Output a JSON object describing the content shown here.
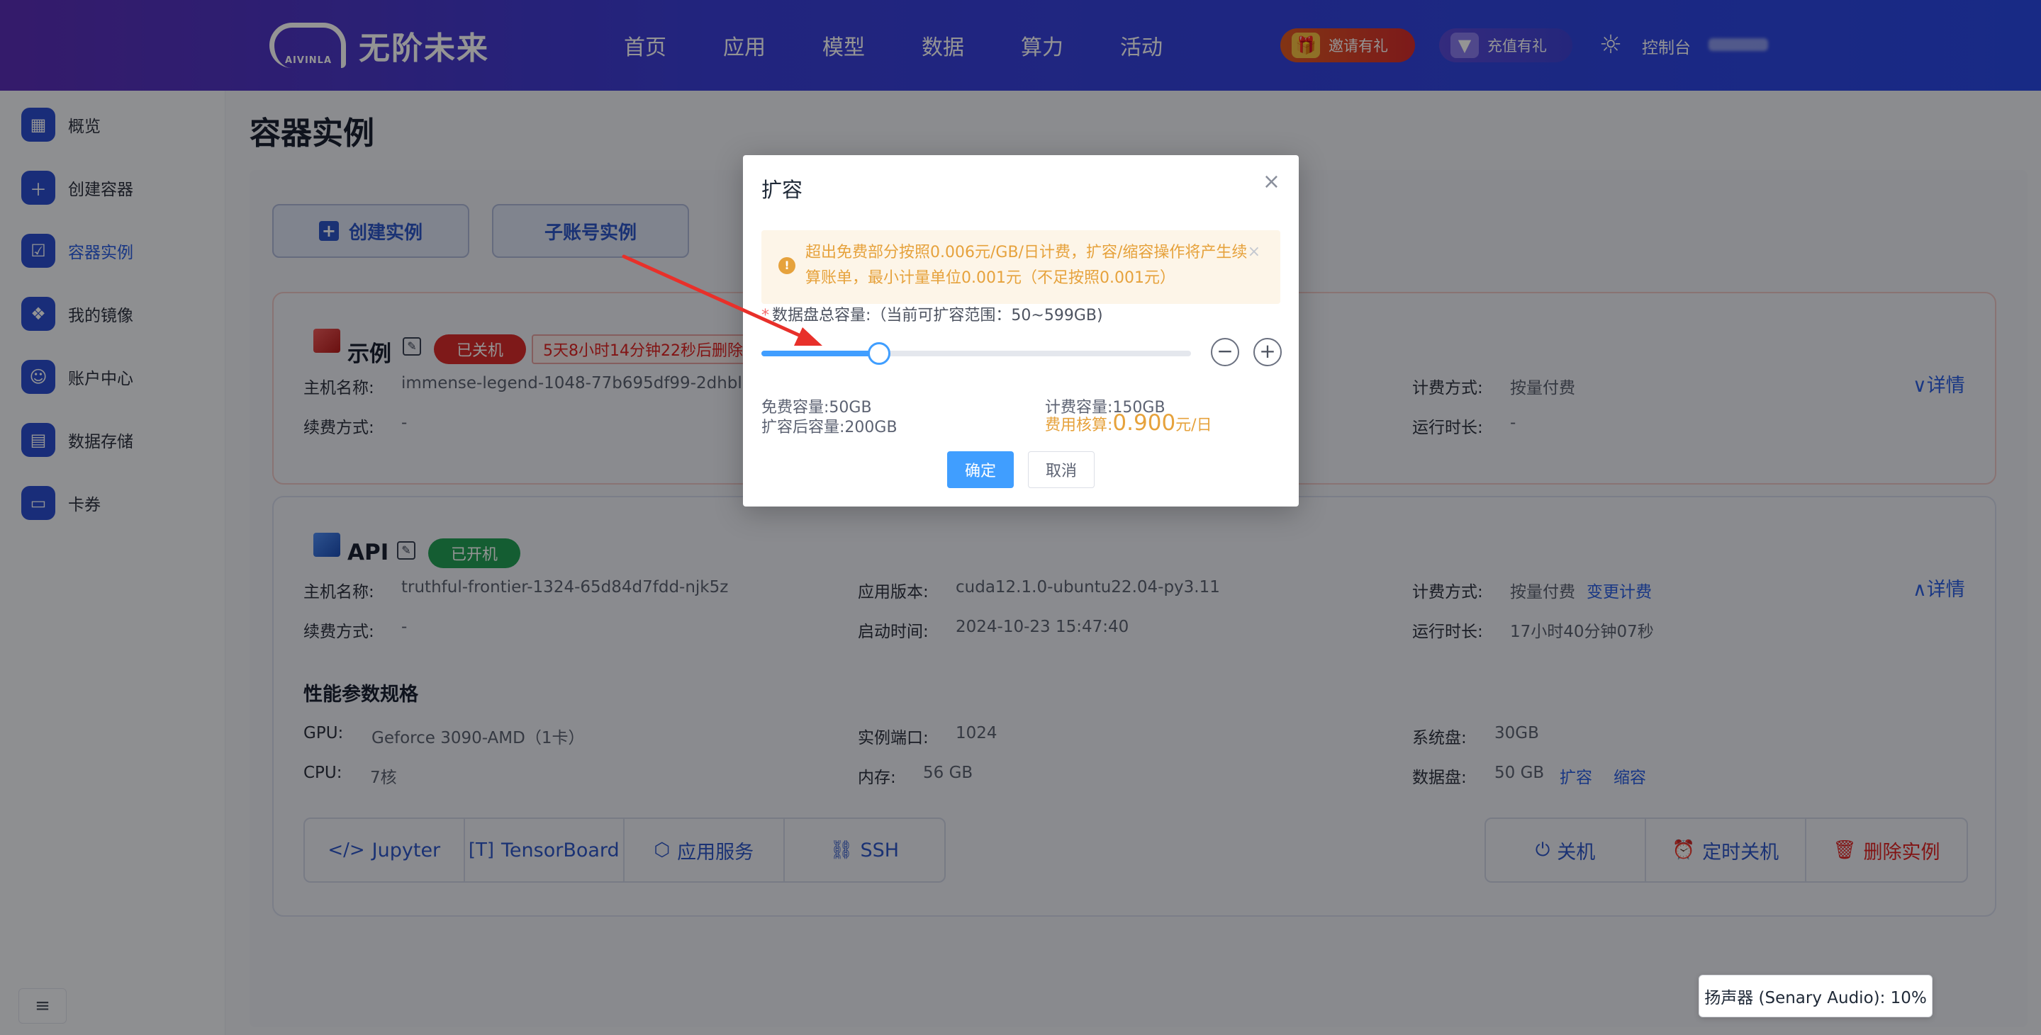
{
  "header": {
    "logo_text": "无阶未来",
    "logo_sub": "AIVINLA",
    "nav": [
      "首页",
      "应用",
      "模型",
      "数据",
      "算力",
      "活动"
    ],
    "invite_label": "邀请有礼",
    "recharge_label": "充值有礼",
    "console_label": "控制台"
  },
  "sidebar": {
    "items": [
      {
        "label": "概览",
        "icon": "grid-icon"
      },
      {
        "label": "创建容器",
        "icon": "plus-icon"
      },
      {
        "label": "容器实例",
        "icon": "checklist-icon",
        "active": true
      },
      {
        "label": "我的镜像",
        "icon": "layers-icon"
      },
      {
        "label": "账户中心",
        "icon": "user-icon"
      },
      {
        "label": "数据存储",
        "icon": "database-icon"
      },
      {
        "label": "卡券",
        "icon": "ticket-icon"
      }
    ],
    "collapse_glyph": "≡"
  },
  "page": {
    "title": "容器实例",
    "create_btn": "创建实例",
    "sub_btn": "子账号实例"
  },
  "card1": {
    "name": "示例",
    "status": "已关机",
    "countdown": "5天8小时14分钟22秒后删除",
    "host_label": "主机名称:",
    "host": "immense-legend-1048-77b695df99-2dhbl",
    "renew_label": "续费方式:",
    "renew": "-",
    "billing_label": "计费方式:",
    "billing": "按量付费",
    "runtime_label": "运行时长:",
    "runtime": "-",
    "detail": "详情"
  },
  "card2": {
    "name": "API",
    "status": "已开机",
    "host_label": "主机名称:",
    "host": "truthful-frontier-1324-65d84d7fdd-njk5z",
    "renew_label": "续费方式:",
    "renew": "-",
    "app_ver_label": "应用版本:",
    "app_ver": "cuda12.1.0-ubuntu22.04-py3.11",
    "start_label": "启动时间:",
    "start": "2024-10-23 15:47:40",
    "billing_label": "计费方式:",
    "billing": "按量付费",
    "change_billing": "变更计费",
    "runtime_label": "运行时长:",
    "runtime": "17小时40分钟07秒",
    "detail": "详情",
    "spec_title": "性能参数规格",
    "gpu_label": "GPU:",
    "gpu": "Geforce 3090-AMD（1卡）",
    "cpu_label": "CPU:",
    "cpu": "7核",
    "port_label": "实例端口:",
    "port": "1024",
    "mem_label": "内存:",
    "mem": "56 GB",
    "sysdisk_label": "系统盘:",
    "sysdisk": "30GB",
    "datadisk_label": "数据盘:",
    "datadisk": "50 GB",
    "expand": "扩容",
    "shrink": "缩容",
    "tools": [
      "Jupyter",
      "TensorBoard",
      "应用服务",
      "SSH"
    ],
    "actions": [
      "关机",
      "定时关机",
      "删除实例"
    ]
  },
  "modal": {
    "title": "扩容",
    "alert": "超出免费部分按照0.006元/GB/日计费，扩容/缩容操作将产生续算账单，最小计量单位0.001元（不足按照0.001元）",
    "cap_label": "数据盘总容量:（当前可扩容范围：50~599GB)",
    "slider": {
      "min": 50,
      "max": 599,
      "value": 200
    },
    "free_label": "免费容量:",
    "free": "50GB",
    "after_label": "扩容后容量:",
    "after": "200GB",
    "charge_label": "计费容量:",
    "charge": "150GB",
    "cost_label": "费用核算:",
    "cost": "0.900",
    "cost_unit": "元/日",
    "ok": "确定",
    "cancel": "取消"
  },
  "toast": "扬声器 (Senary Audio): 10%",
  "colors": {
    "primary": "#409eff",
    "brand": "#2b5fe3",
    "warning": "#e6a23c",
    "danger": "#d92b2b",
    "success": "#23a057"
  }
}
